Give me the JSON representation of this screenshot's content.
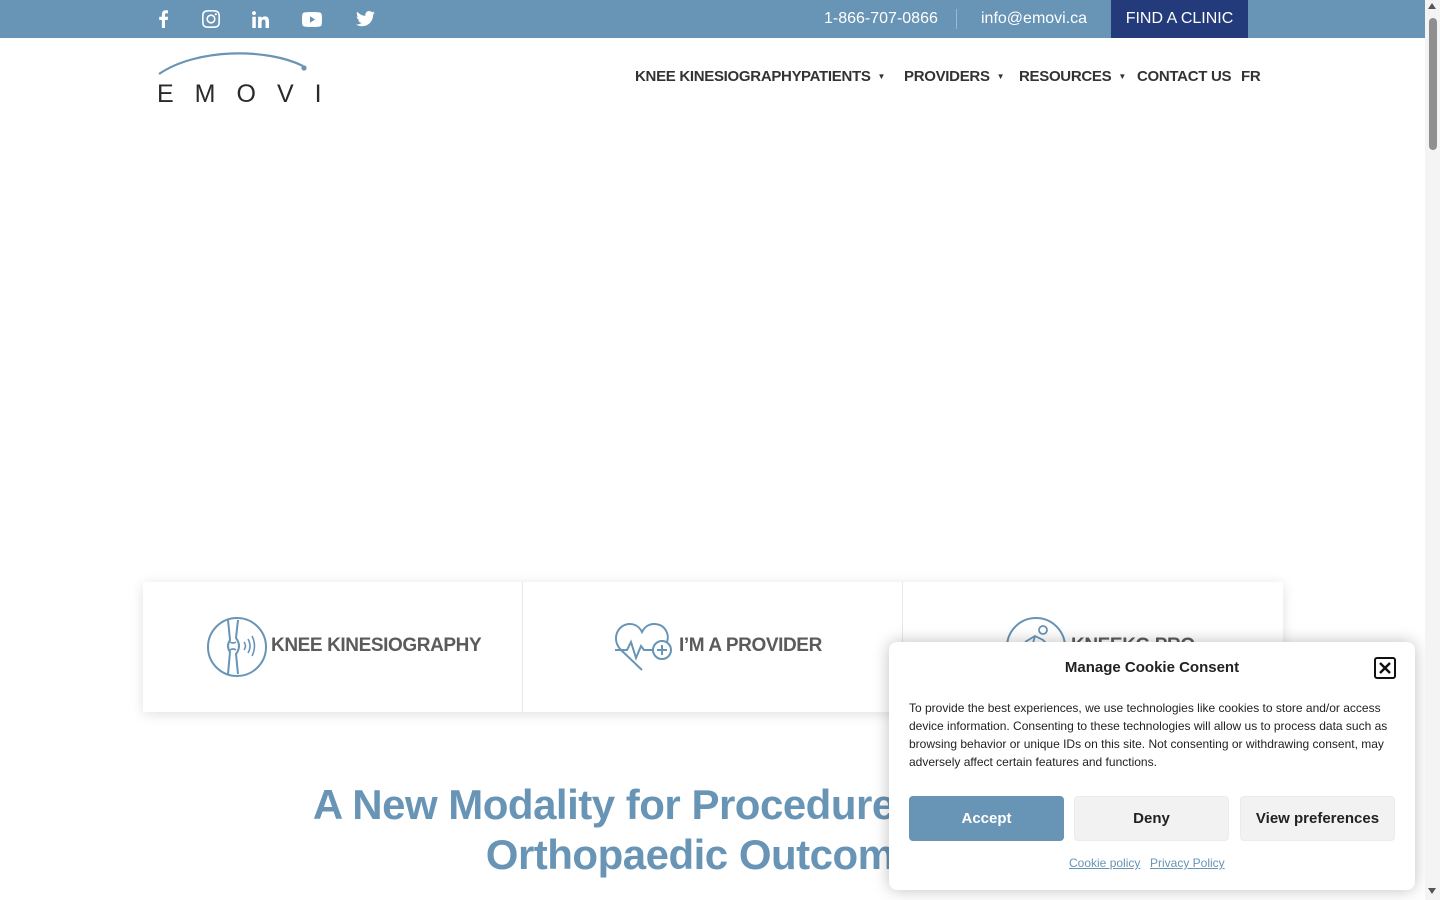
{
  "topbar": {
    "social": [
      "facebook-icon",
      "instagram-icon",
      "linkedin-icon",
      "youtube-icon",
      "twitter-icon"
    ],
    "phone": "1-866-707-0866",
    "email": "info@emovi.ca",
    "cta": "FIND A CLINIC",
    "bg_color": "#6894b6",
    "cta_color": "#233a7b"
  },
  "logo": {
    "text": "EMOVI"
  },
  "nav": {
    "items": [
      {
        "label": "KNEE KINESIOGRAPHY",
        "dropdown": false
      },
      {
        "label": "PATIENTS",
        "dropdown": true
      },
      {
        "label": "PROVIDERS",
        "dropdown": true
      },
      {
        "label": "RESOURCES",
        "dropdown": true
      },
      {
        "label": "CONTACT US",
        "dropdown": false
      },
      {
        "label": "FR",
        "dropdown": false
      }
    ]
  },
  "cards": [
    {
      "label": "KNEE KINESIOGRAPHY",
      "icon": "knee-joint-icon"
    },
    {
      "label": "I’M A PROVIDER",
      "icon": "heart-pulse-icon"
    },
    {
      "label": "KNEEKG PRO",
      "icon": "runner-icon"
    }
  ],
  "headline": {
    "line1": "A New Modality for Procedure Innovation",
    "line2": "Orthopaedic Outcomes"
  },
  "cookie": {
    "title": "Manage Cookie Consent",
    "body": "To provide the best experiences, we use technologies like cookies to store and/or access device information. Consenting to these technologies will allow us to process data such as browsing behavior or unique IDs on this site. Not consenting or withdrawing consent, may adversely affect certain features and functions.",
    "accept": "Accept",
    "deny": "Deny",
    "preferences": "View preferences",
    "cookie_policy": "Cookie policy",
    "privacy_policy": "Privacy Policy"
  },
  "colors": {
    "accent": "#6894b6",
    "dark_blue": "#233a7b"
  }
}
